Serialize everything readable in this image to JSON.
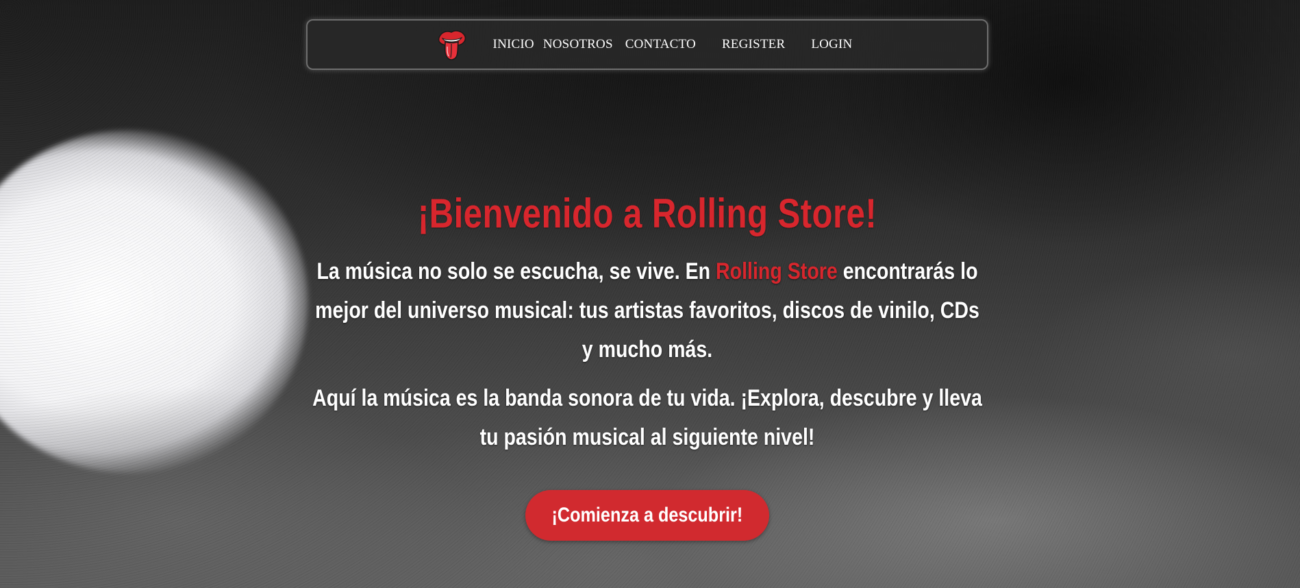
{
  "navbar": {
    "logo_icon": "rolling-stones-tongue-logo-icon",
    "links": [
      {
        "label": "INICIO"
      },
      {
        "label": "NOSOTROS"
      },
      {
        "label": "CONTACTO"
      },
      {
        "label": "REGISTER"
      },
      {
        "label": "LOGIN"
      }
    ]
  },
  "hero": {
    "title": "¡Bienvenido a Rolling Store!",
    "paragraph1": {
      "before": "La música no solo se escucha, se vive. En ",
      "brand": "Rolling Store",
      "after": " encontrarás lo mejor del universo musical: tus artistas favoritos, discos de vinilo, CDs y mucho más."
    },
    "paragraph2": "Aquí la música es la banda sonora de tu vida. ¡Explora, descubre y lleva tu pasión musical al siguiente nivel!",
    "cta_label": "¡Comienza a descubrir!"
  },
  "colors": {
    "accent_red": "#d8262d",
    "button_red": "#d12a2f",
    "navbar_bg": "#282828",
    "text_white": "#ffffff"
  }
}
